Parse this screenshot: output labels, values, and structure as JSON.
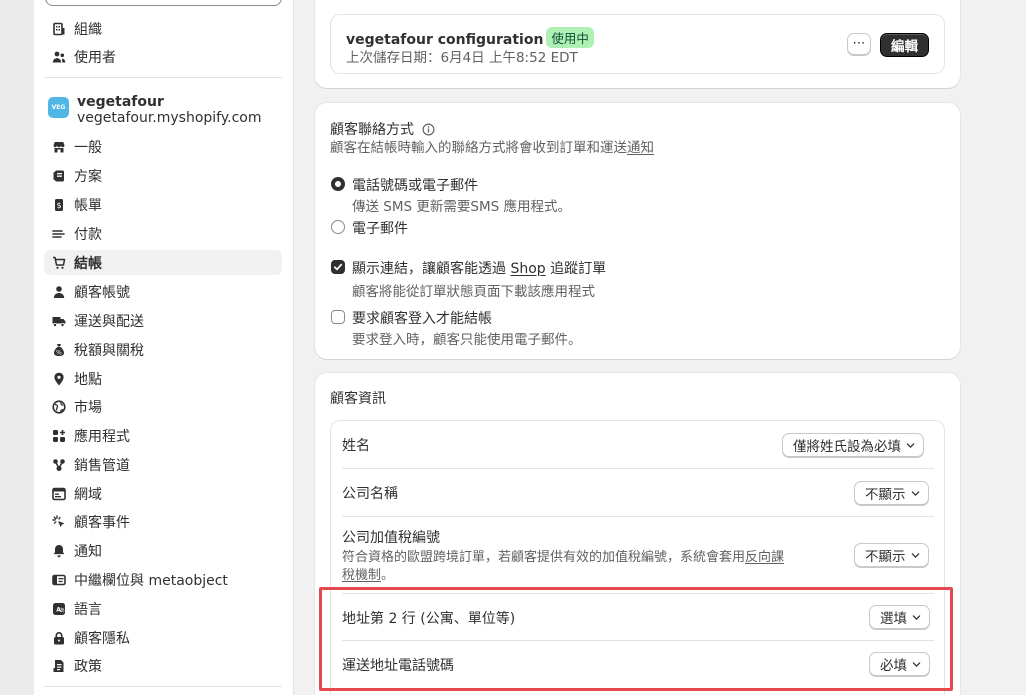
{
  "sidebar": {
    "items": [
      {
        "label": "組織",
        "icon": "building-icon"
      },
      {
        "label": "使用者",
        "icon": "users-icon"
      },
      {
        "label": "一般",
        "icon": "store-icon"
      },
      {
        "label": "方案",
        "icon": "plan-icon"
      },
      {
        "label": "帳單",
        "icon": "billing-icon"
      },
      {
        "label": "付款",
        "icon": "payments-icon"
      },
      {
        "label": "結帳",
        "icon": "cart-icon",
        "active": true
      },
      {
        "label": "顧客帳號",
        "icon": "person-icon"
      },
      {
        "label": "運送與配送",
        "icon": "truck-icon"
      },
      {
        "label": "稅額與關稅",
        "icon": "tax-icon"
      },
      {
        "label": "地點",
        "icon": "location-icon"
      },
      {
        "label": "市場",
        "icon": "globe-icon"
      },
      {
        "label": "應用程式",
        "icon": "apps-icon"
      },
      {
        "label": "銷售管道",
        "icon": "channels-icon"
      },
      {
        "label": "網域",
        "icon": "domain-icon"
      },
      {
        "label": "顧客事件",
        "icon": "events-icon"
      },
      {
        "label": "通知",
        "icon": "bell-icon"
      },
      {
        "label": "中繼欄位與 metaobject",
        "icon": "metafields-icon"
      },
      {
        "label": "語言",
        "icon": "language-icon"
      },
      {
        "label": "顧客隱私",
        "icon": "lock-icon"
      },
      {
        "label": "政策",
        "icon": "policy-icon"
      }
    ],
    "store": {
      "badge": "VEG",
      "name": "vegetafour",
      "domain": "vegetafour.myshopify.com"
    }
  },
  "config": {
    "name": "vegetafour configuration",
    "status": "使用中",
    "saved": "上次儲存日期：6月4日 上午8:52 EDT",
    "more": "⋯",
    "edit": "編輯"
  },
  "contact": {
    "title": "顧客聯絡方式",
    "desc_pre": "顧客在結帳時輸入的聯絡方式將會收到訂單和運送",
    "desc_link": "通知",
    "options": [
      {
        "label": "電話號碼或電子郵件",
        "hint": "傳送 SMS 更新需要SMS 應用程式。",
        "selected": true
      },
      {
        "label": "電子郵件",
        "hint": "",
        "selected": false
      }
    ],
    "checks": [
      {
        "pre": "顯示連結，讓顧客能透過 ",
        "link": "Shop",
        "post": " 追蹤訂單",
        "hint": "顧客將能從訂單狀態頁面下載該應用程式",
        "checked": true
      },
      {
        "pre": "要求顧客登入才能結帳",
        "link": "",
        "post": "",
        "hint": "要求登入時，顧客只能使用電子郵件。",
        "checked": false
      }
    ]
  },
  "customer_info": {
    "title": "顧客資訊",
    "rows": [
      {
        "label": "姓名",
        "value": "僅將姓氏設為必填"
      },
      {
        "label": "公司名稱",
        "value": "不顯示"
      },
      {
        "label": "公司加值稅編號",
        "value": "不顯示",
        "desc_line1": "符合資格的歐盟跨境訂單，若顧客提供有效的加值稅編號，系統會套用",
        "desc_link1": "反向課",
        "desc_link2": "稅機制",
        "desc_end": "。"
      },
      {
        "label": "地址第 2 行 (公寓、單位等)",
        "value": "選填"
      },
      {
        "label": "運送地址電話號碼",
        "value": "必填"
      }
    ]
  },
  "colors": {
    "highlight": "#e5484d",
    "badge_bg": "#aff0b5",
    "store_badge": "#4fb6e6"
  }
}
